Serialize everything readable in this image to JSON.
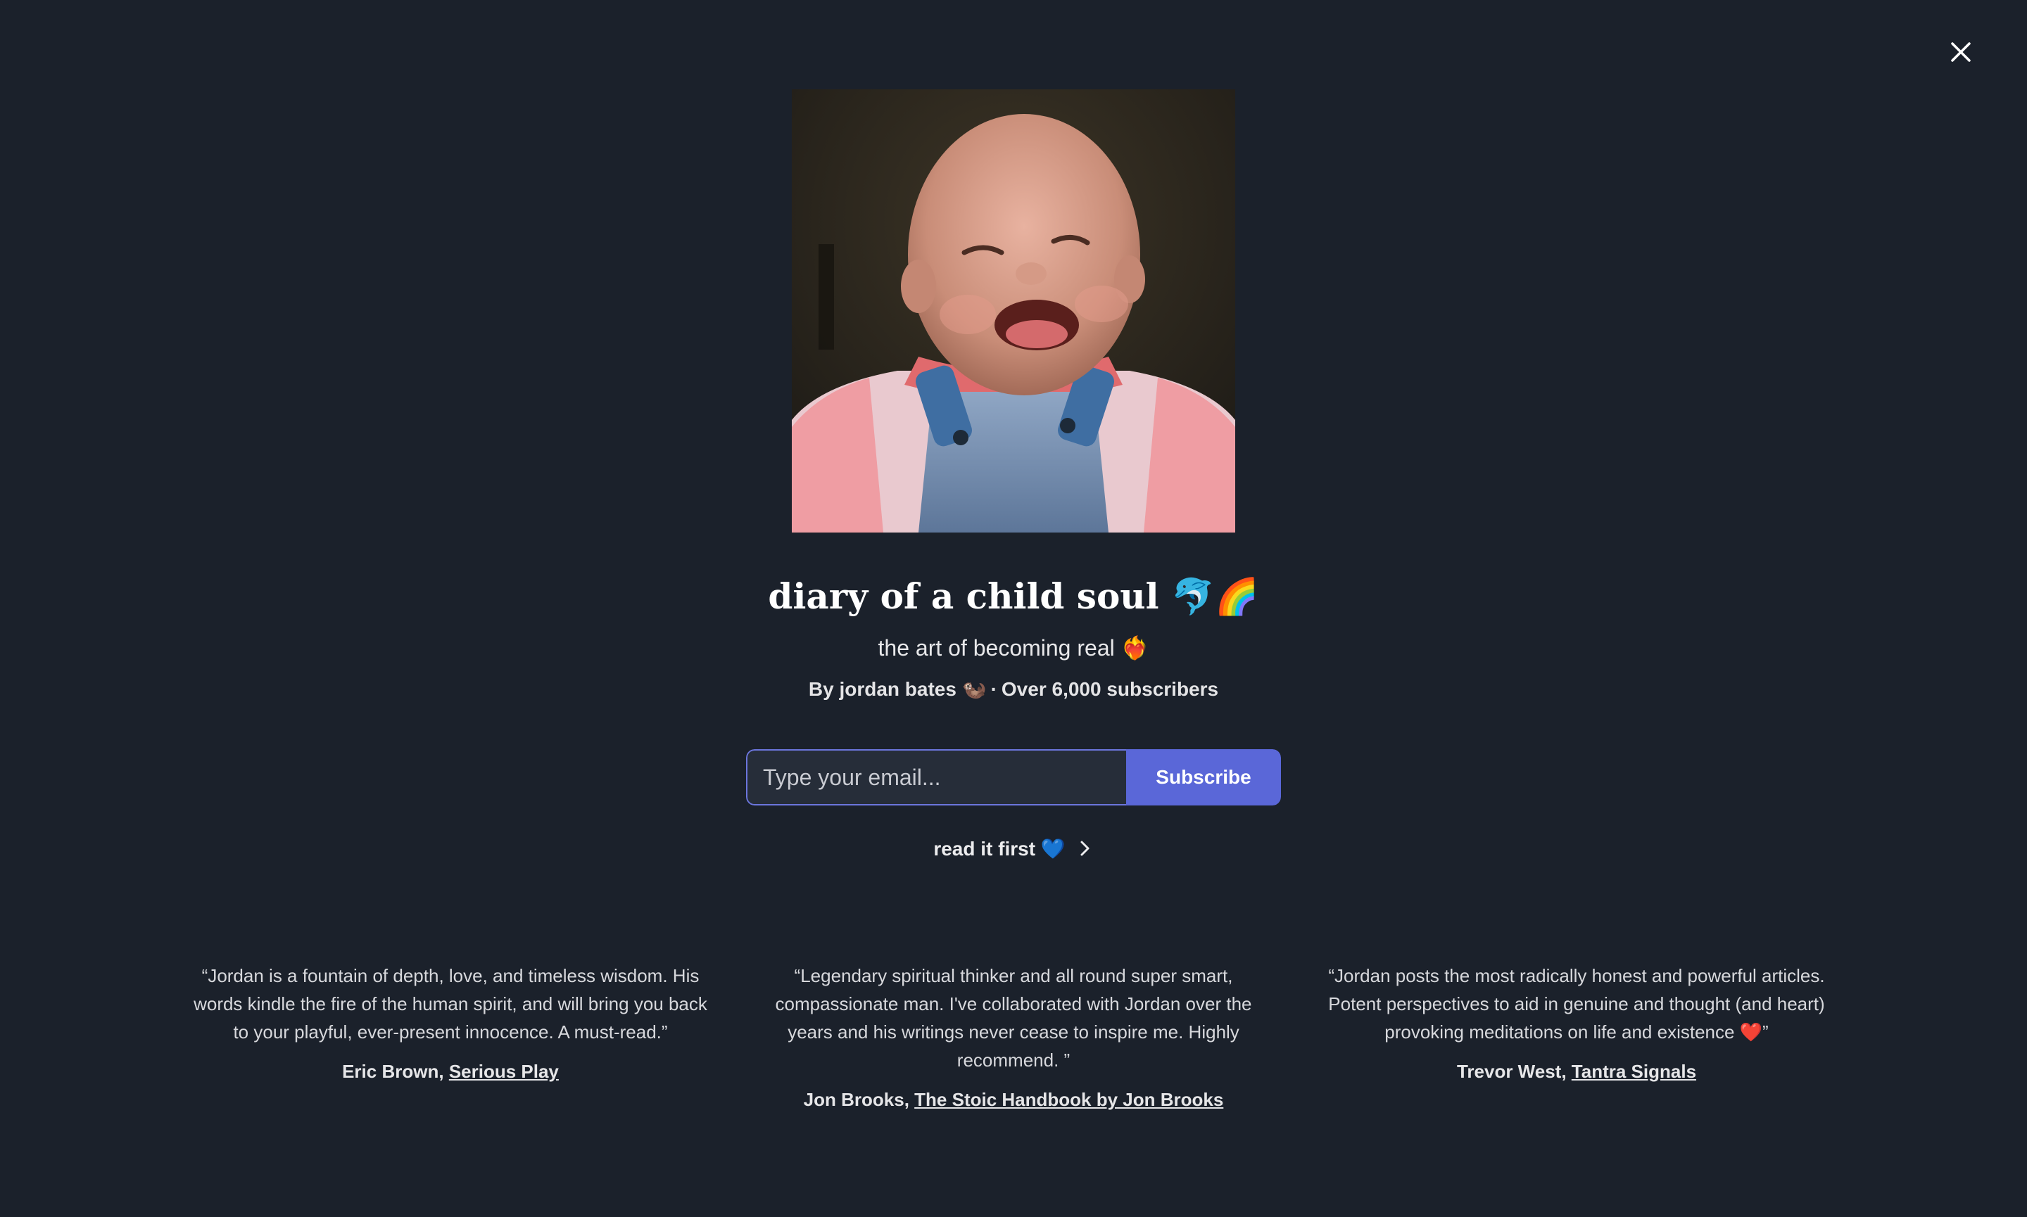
{
  "close": {
    "icon": "close-icon",
    "label": "Close"
  },
  "publication": {
    "photo_alt": "Baby laughing in denim overalls",
    "title": "diary of a child soul 🐬🌈",
    "subtitle": "the art of becoming real ❤️‍🔥",
    "author_line": "By jordan bates 🦦",
    "separator": "·",
    "subscribers": "Over 6,000 subscribers"
  },
  "subscribe": {
    "email_placeholder": "Type your email...",
    "button_label": "Subscribe"
  },
  "read_first": {
    "label": "read it first 💙",
    "icon": "chevron-right-icon"
  },
  "testimonials": [
    {
      "quote": "“Jordan is a fountain of depth, love, and timeless wisdom. His words kindle the fire of the human spirit, and will bring you back to your playful, ever-present innocence. A must-read.”",
      "author": "Eric Brown,",
      "link": "Serious Play"
    },
    {
      "quote": "“Legendary spiritual thinker and all round super smart, compassionate man. I've collaborated with Jordan over the years and his writings never cease to inspire me. Highly recommend. ”",
      "author": "Jon Brooks,",
      "link": "The Stoic Handbook by Jon Brooks"
    },
    {
      "quote": "“Jordan posts the most radically honest and powerful articles. Potent perspectives to aid in genuine and thought (and heart) provoking meditations on life and existence ❤️”",
      "author": "Trevor West,",
      "link": "Tantra Signals"
    }
  ],
  "colors": {
    "background": "#1b212b",
    "accent": "#5a67d8",
    "input_border": "#6b75dc"
  }
}
